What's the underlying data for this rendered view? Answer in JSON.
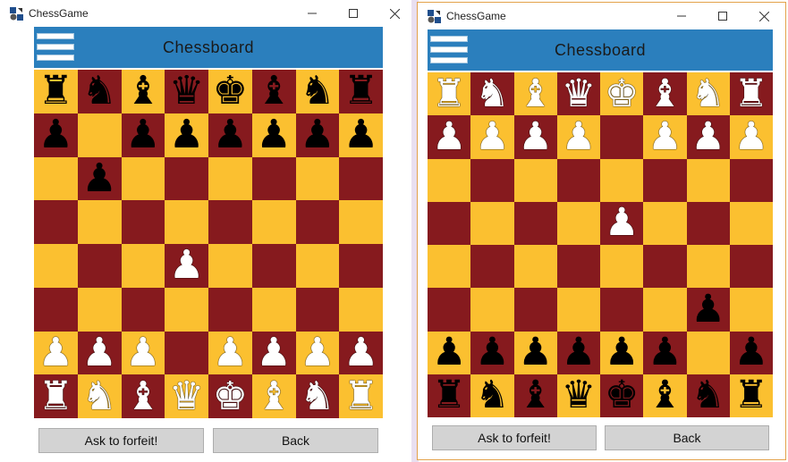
{
  "colors": {
    "header": "#2b7fbd",
    "light_square": "#fbc030",
    "dark_square": "#861a1e",
    "button": "#d3d3d3",
    "right_window_border": "#e3a24a"
  },
  "windows": [
    {
      "id": "left",
      "title": "ChessGame",
      "header_title": "Chessboard",
      "board": [
        [
          "br",
          "bn",
          "bb",
          "bq",
          "bk",
          "bb",
          "bn",
          "br"
        ],
        [
          "bp",
          "",
          "bp",
          "bp",
          "bp",
          "bp",
          "bp",
          "bp"
        ],
        [
          "",
          "bp",
          "",
          "",
          "",
          "",
          "",
          ""
        ],
        [
          "",
          "",
          "",
          "",
          "",
          "",
          "",
          ""
        ],
        [
          "",
          "",
          "",
          "wp",
          "",
          "",
          "",
          ""
        ],
        [
          "",
          "",
          "",
          "",
          "",
          "",
          "",
          ""
        ],
        [
          "wp",
          "wp",
          "wp",
          "",
          "wp",
          "wp",
          "wp",
          "wp"
        ],
        [
          "wr",
          "wn",
          "wb",
          "wq",
          "wk",
          "wb",
          "wn",
          "wr"
        ]
      ],
      "buttons": {
        "forfeit": "Ask to forfeit!",
        "back": "Back"
      }
    },
    {
      "id": "right",
      "title": "ChessGame",
      "header_title": "Chessboard",
      "board": [
        [
          "wr",
          "wn",
          "wb",
          "wq",
          "wk",
          "wb",
          "wn",
          "wr"
        ],
        [
          "wp",
          "wp",
          "wp",
          "wp",
          "",
          "wp",
          "wp",
          "wp"
        ],
        [
          "",
          "",
          "",
          "",
          "",
          "",
          "",
          ""
        ],
        [
          "",
          "",
          "",
          "",
          "wp",
          "",
          "",
          ""
        ],
        [
          "",
          "",
          "",
          "",
          "",
          "",
          "",
          ""
        ],
        [
          "",
          "",
          "",
          "",
          "",
          "",
          "bp",
          ""
        ],
        [
          "bp",
          "bp",
          "bp",
          "bp",
          "bp",
          "bp",
          "",
          "bp"
        ],
        [
          "br",
          "bn",
          "bb",
          "bq",
          "bk",
          "bb",
          "bn",
          "br"
        ]
      ],
      "buttons": {
        "forfeit": "Ask to forfeit!",
        "back": "Back"
      }
    }
  ],
  "window_controls": {
    "minimize_icon": "minimize-icon",
    "maximize_icon": "maximize-icon",
    "close_icon": "close-icon"
  }
}
